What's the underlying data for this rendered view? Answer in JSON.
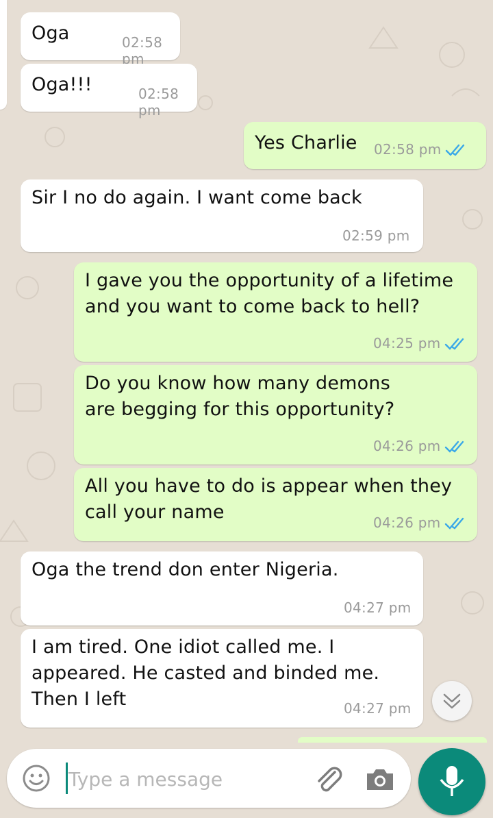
{
  "messages": [
    {
      "dir": "in",
      "text": "Oga",
      "time": "02:58 pm"
    },
    {
      "dir": "in",
      "text": "Oga!!!",
      "time": "02:58 pm"
    },
    {
      "dir": "out",
      "text": "Yes Charlie",
      "time": "02:58 pm",
      "read": true
    },
    {
      "dir": "in",
      "text": "Sir I no do again. I want come back",
      "time": "02:59 pm"
    },
    {
      "dir": "out",
      "text": "I gave you the opportunity of a lifetime\nand you want to come back to hell?",
      "time": "04:25 pm",
      "read": true
    },
    {
      "dir": "out",
      "text": "Do you know how many demons\nare begging for this opportunity?",
      "time": "04:26 pm",
      "read": true
    },
    {
      "dir": "out",
      "text": "All you have to do is appear when they\ncall your name",
      "time": "04:26 pm",
      "read": true
    },
    {
      "dir": "in",
      "text": "Oga the trend don enter Nigeria.",
      "time": "04:27 pm"
    },
    {
      "dir": "in",
      "text": "I am tired. One idiot called me. I\nappeared. He casted and binded me.\nThen I left",
      "time": "04:27 pm"
    }
  ],
  "composer": {
    "placeholder": "Type a message",
    "emoji_icon": "emoji-icon",
    "attach_icon": "paperclip-icon",
    "camera_icon": "camera-icon",
    "mic_icon": "microphone-icon"
  },
  "scroll_down_icon": "double-chevron-down-icon",
  "colors": {
    "background": "#e6ded4",
    "incoming": "#ffffff",
    "outgoing": "#e2fdc6",
    "accent": "#0b8a7a",
    "read_tick": "#3aa8e8",
    "time": "#9a9a9a"
  }
}
